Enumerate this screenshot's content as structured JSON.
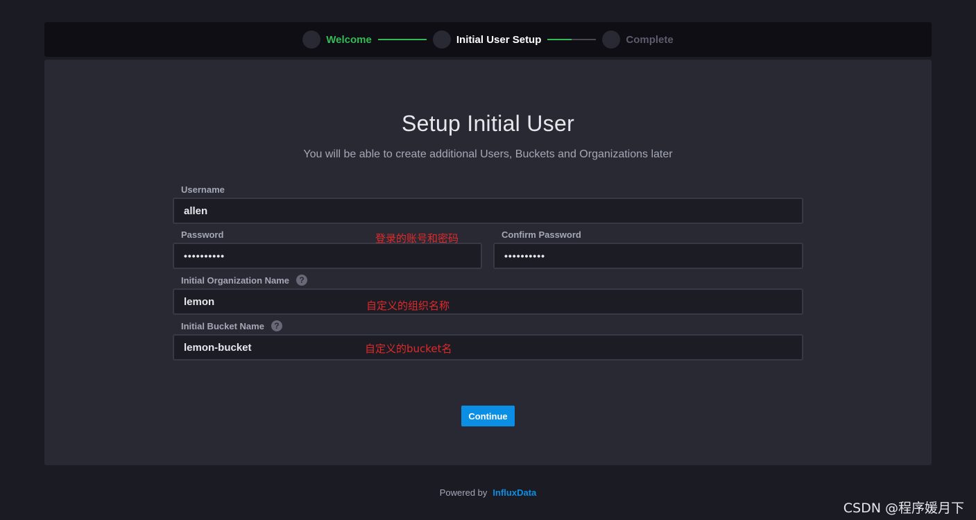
{
  "stepper": {
    "steps": [
      {
        "label": "Welcome",
        "state": "done"
      },
      {
        "label": "Initial User Setup",
        "state": "current"
      },
      {
        "label": "Complete",
        "state": "pending"
      }
    ]
  },
  "form": {
    "title": "Setup Initial User",
    "subtitle": "You will be able to create additional Users, Buckets and Organizations later",
    "username_label": "Username",
    "username_value": "allen",
    "password_label": "Password",
    "password_value": "••••••••••",
    "confirm_password_label": "Confirm Password",
    "confirm_password_value": "••••••••••",
    "org_label": "Initial Organization Name",
    "org_value": "lemon",
    "bucket_label": "Initial Bucket Name",
    "bucket_value": "lemon-bucket",
    "help_glyph": "?",
    "continue_label": "Continue"
  },
  "annotations": {
    "credentials": "登录的账号和密码",
    "org": "自定义的组织名称",
    "bucket": "自定义的bucket名"
  },
  "footer": {
    "powered_by": "Powered by",
    "brand": "InfluxData"
  },
  "watermark": "CSDN @程序媛月下",
  "colors": {
    "accent_green": "#34bb55",
    "accent_blue": "#0b8fe4",
    "annotation_red": "#e02a2a"
  }
}
